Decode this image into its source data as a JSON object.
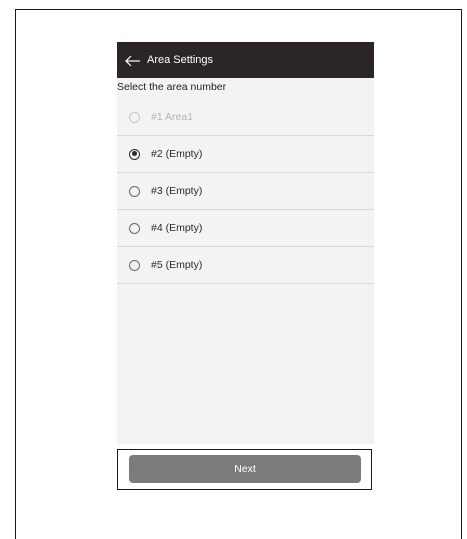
{
  "header": {
    "title": "Area Settings",
    "back_icon": "arrow-left-icon"
  },
  "prompt": "Select the area number",
  "areas": [
    {
      "label": "#1 Area1",
      "state": "disabled"
    },
    {
      "label": "#2 (Empty)",
      "state": "selected"
    },
    {
      "label": "#3 (Empty)",
      "state": "unselected"
    },
    {
      "label": "#4 (Empty)",
      "state": "unselected"
    },
    {
      "label": "#5 (Empty)",
      "state": "unselected"
    }
  ],
  "next_button": {
    "label": "Next"
  },
  "colors": {
    "title_bar": "#2b2625",
    "screen_background": "#f3f3f3",
    "button": "#7b7b7b"
  }
}
